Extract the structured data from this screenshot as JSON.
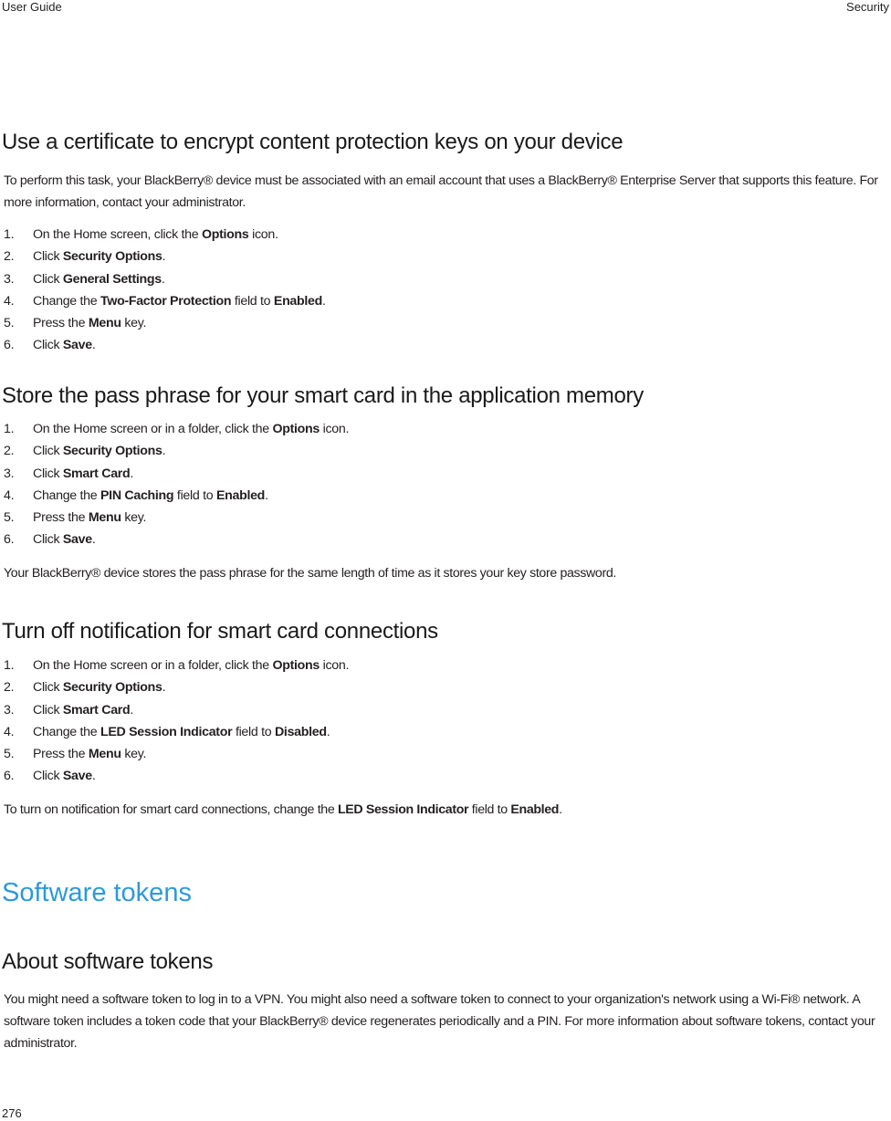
{
  "header": {
    "left": "User Guide",
    "right": "Security"
  },
  "footer": {
    "page_number": "276"
  },
  "sections": [
    {
      "title": "Use a certificate to encrypt content protection keys on your device",
      "intro": "To perform this task, your BlackBerry® device must be associated with an email account that uses a BlackBerry® Enterprise Server that supports this feature. For more information, contact your administrator.",
      "steps": [
        {
          "num": "1.",
          "parts": [
            {
              "t": "On the Home screen, click the "
            },
            {
              "t": "Options",
              "b": true
            },
            {
              "t": " icon."
            }
          ]
        },
        {
          "num": "2.",
          "parts": [
            {
              "t": "Click "
            },
            {
              "t": "Security Options",
              "b": true
            },
            {
              "t": "."
            }
          ]
        },
        {
          "num": "3.",
          "parts": [
            {
              "t": "Click "
            },
            {
              "t": "General Settings",
              "b": true
            },
            {
              "t": "."
            }
          ]
        },
        {
          "num": "4.",
          "parts": [
            {
              "t": "Change the "
            },
            {
              "t": "Two-Factor Protection",
              "b": true
            },
            {
              "t": " field to "
            },
            {
              "t": "Enabled",
              "b": true
            },
            {
              "t": "."
            }
          ]
        },
        {
          "num": "5.",
          "parts": [
            {
              "t": "Press the "
            },
            {
              "t": "Menu",
              "b": true
            },
            {
              "t": " key."
            }
          ]
        },
        {
          "num": "6.",
          "parts": [
            {
              "t": "Click "
            },
            {
              "t": "Save",
              "b": true
            },
            {
              "t": "."
            }
          ]
        }
      ]
    },
    {
      "title": "Store the pass phrase for your smart card in the application memory",
      "steps": [
        {
          "num": "1.",
          "parts": [
            {
              "t": "On the Home screen or in a folder, click the "
            },
            {
              "t": "Options",
              "b": true
            },
            {
              "t": " icon."
            }
          ]
        },
        {
          "num": "2.",
          "parts": [
            {
              "t": "Click "
            },
            {
              "t": "Security Options",
              "b": true
            },
            {
              "t": "."
            }
          ]
        },
        {
          "num": "3.",
          "parts": [
            {
              "t": "Click "
            },
            {
              "t": "Smart Card",
              "b": true
            },
            {
              "t": "."
            }
          ]
        },
        {
          "num": "4.",
          "parts": [
            {
              "t": "Change the "
            },
            {
              "t": "PIN Caching",
              "b": true
            },
            {
              "t": " field to "
            },
            {
              "t": "Enabled",
              "b": true
            },
            {
              "t": "."
            }
          ]
        },
        {
          "num": "5.",
          "parts": [
            {
              "t": "Press the "
            },
            {
              "t": "Menu",
              "b": true
            },
            {
              "t": " key."
            }
          ]
        },
        {
          "num": "6.",
          "parts": [
            {
              "t": "Click "
            },
            {
              "t": "Save",
              "b": true
            },
            {
              "t": "."
            }
          ]
        }
      ],
      "note": [
        {
          "t": "Your BlackBerry® device stores the pass phrase for the same length of time as it stores your key store password."
        }
      ]
    },
    {
      "title": "Turn off notification for smart card connections",
      "steps": [
        {
          "num": "1.",
          "parts": [
            {
              "t": "On the Home screen or in a folder, click the "
            },
            {
              "t": "Options",
              "b": true
            },
            {
              "t": " icon."
            }
          ]
        },
        {
          "num": "2.",
          "parts": [
            {
              "t": "Click "
            },
            {
              "t": "Security Options",
              "b": true
            },
            {
              "t": "."
            }
          ]
        },
        {
          "num": "3.",
          "parts": [
            {
              "t": "Click "
            },
            {
              "t": "Smart Card",
              "b": true
            },
            {
              "t": "."
            }
          ]
        },
        {
          "num": "4.",
          "parts": [
            {
              "t": "Change the "
            },
            {
              "t": "LED Session Indicator",
              "b": true
            },
            {
              "t": " field to "
            },
            {
              "t": "Disabled",
              "b": true
            },
            {
              "t": "."
            }
          ]
        },
        {
          "num": "5.",
          "parts": [
            {
              "t": "Press the "
            },
            {
              "t": "Menu",
              "b": true
            },
            {
              "t": " key."
            }
          ]
        },
        {
          "num": "6.",
          "parts": [
            {
              "t": "Click "
            },
            {
              "t": "Save",
              "b": true
            },
            {
              "t": "."
            }
          ]
        }
      ],
      "note": [
        {
          "t": "To turn on notification for smart card connections, change the "
        },
        {
          "t": "LED Session Indicator",
          "b": true
        },
        {
          "t": " field to "
        },
        {
          "t": "Enabled",
          "b": true
        },
        {
          "t": "."
        }
      ]
    }
  ],
  "chapter": {
    "title": "Software tokens",
    "color": "#2d9ad8",
    "subsection": {
      "title": "About software tokens",
      "body": "You might need a software token to log in to a VPN. You might also need a software token to connect to your organization's network using a Wi-Fi® network. A software token includes a token code that your BlackBerry® device regenerates periodically and a PIN. For more information about software tokens, contact your administrator."
    }
  }
}
